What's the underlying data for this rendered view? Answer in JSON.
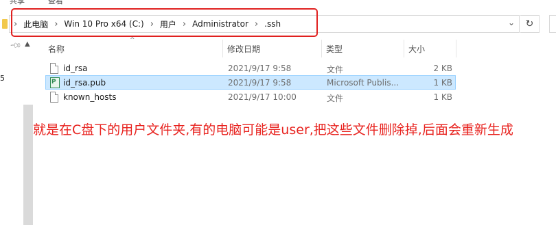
{
  "ribbon_tabs": [
    "共享",
    "查看"
  ],
  "breadcrumb": [
    "此电脑",
    "Win 10 Pro x64 (C:)",
    "用户",
    "Administrator",
    ".ssh"
  ],
  "nav_stray_text": "5",
  "columns": {
    "name": "名称",
    "modified": "修改日期",
    "type": "类型",
    "size": "大小"
  },
  "files": [
    {
      "name": "id_rsa",
      "modified": "2021/9/17 9:58",
      "type": "文件",
      "size": "2 KB",
      "icon": "file-icon",
      "selected": false
    },
    {
      "name": "id_rsa.pub",
      "modified": "2021/9/17 9:58",
      "type": "Microsoft Publis...",
      "size": "1 KB",
      "icon": "publisher-file-icon",
      "selected": true
    },
    {
      "name": "known_hosts",
      "modified": "2021/9/17 10:00",
      "type": "文件",
      "size": "1 KB",
      "icon": "file-icon",
      "selected": false
    }
  ],
  "annotation": "就是在C盘下的用户文件夹,有的电脑可能是user,把这些文件删除掉,后面会重新生成",
  "colors": {
    "annotation_red": "#e8231f",
    "selection_bg": "#cce8ff",
    "selection_border": "#99d1ff"
  }
}
